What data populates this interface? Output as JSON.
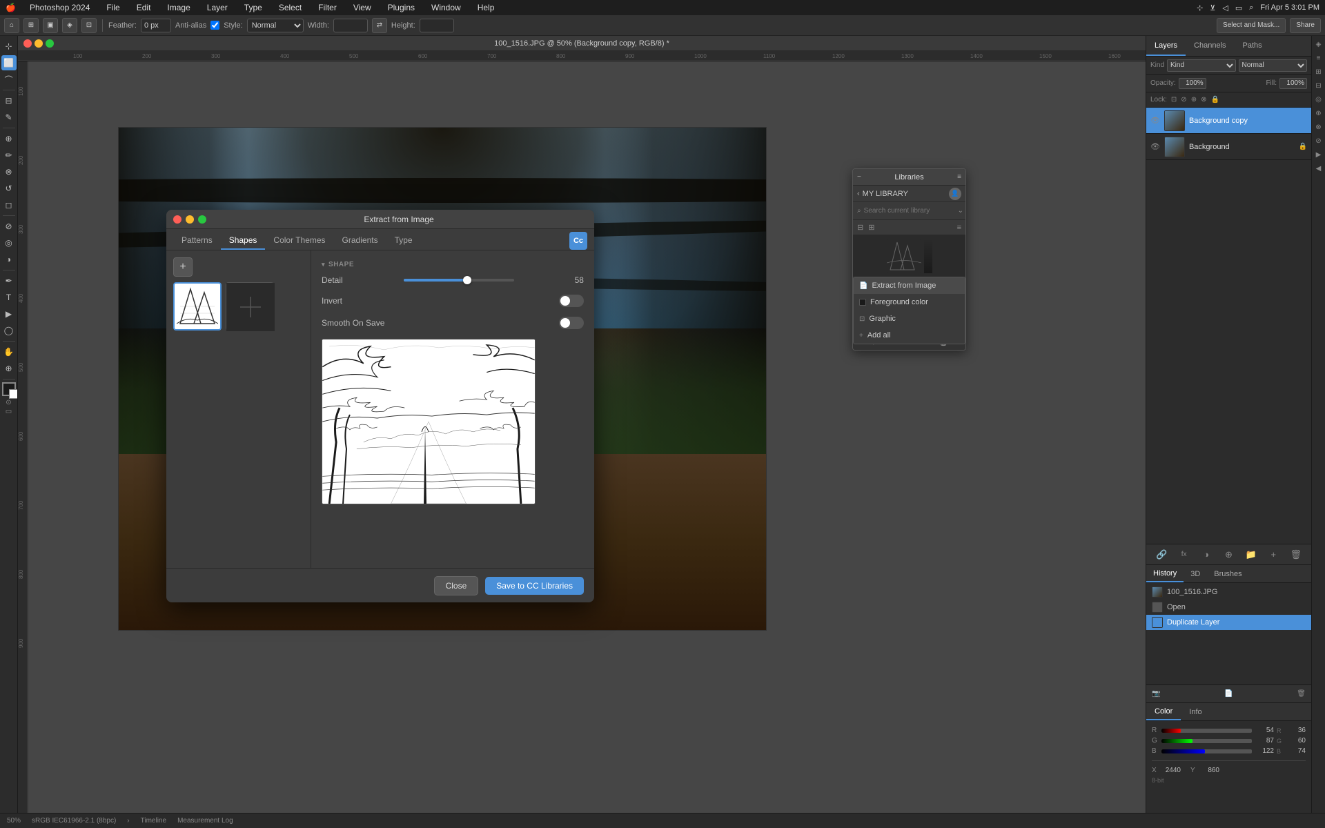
{
  "app": {
    "name": "Photoshop 2024",
    "title_bar": "100_1516.JPG @ 50% (Background copy, RGB/8) *",
    "zoom": "50%",
    "color_profile": "sRGB IEC61966-2.1 (8bpc)"
  },
  "menu_bar": {
    "apple": "🍎",
    "items": [
      "Photoshop 2024",
      "File",
      "Edit",
      "Image",
      "Layer",
      "Type",
      "Select",
      "Filter",
      "View",
      "Plugins",
      "Window",
      "Help"
    ],
    "right": [
      "bluetooth_icon",
      "wifi_icon",
      "volume_icon",
      "battery_icon",
      "search_icon",
      "Fri Apr 5  3:01 PM"
    ]
  },
  "toolbar": {
    "feather_label": "Feather:",
    "feather_value": "0 px",
    "anti_alias_label": "Anti-alias",
    "style_label": "Style:",
    "style_value": "Normal",
    "width_label": "Width:",
    "height_label": "Height:",
    "select_mask_label": "Select and Mask..."
  },
  "extract_dialog": {
    "title": "Extract from Image",
    "tabs": [
      "Patterns",
      "Shapes",
      "Color Themes",
      "Gradients",
      "Type"
    ],
    "active_tab": "Shapes",
    "cc_btn": "Cc",
    "section": "SHAPE",
    "detail_label": "Detail",
    "detail_value": "58",
    "invert_label": "Invert",
    "smooth_on_save_label": "Smooth On Save",
    "close_btn": "Close",
    "save_btn": "Save to CC Libraries"
  },
  "libraries_panel": {
    "title": "Libraries",
    "my_library": "MY LIBRARY",
    "search_placeholder": "Search current library",
    "dropdown_items": [
      {
        "label": "Extract from Image",
        "icon": "document"
      },
      {
        "label": "Foreground color",
        "icon": "color"
      },
      {
        "label": "Graphic",
        "icon": "graphic"
      },
      {
        "label": "Add all",
        "icon": "plus"
      }
    ]
  },
  "layers_panel": {
    "tabs": [
      "Layers",
      "Channels",
      "Paths"
    ],
    "active_tab": "Layers",
    "blend_mode": "Normal",
    "opacity_label": "Opacity:",
    "opacity_value": "100%",
    "fill_label": "Fill:",
    "fill_value": "100%",
    "lock_label": "Lock:",
    "layers": [
      {
        "name": "Background copy",
        "visible": true,
        "active": true,
        "locked": false
      },
      {
        "name": "Background",
        "visible": true,
        "active": false,
        "locked": true
      }
    ]
  },
  "history_panel": {
    "tabs": [
      "History",
      "3D",
      "Brushes"
    ],
    "active_tab": "History",
    "items": [
      {
        "label": "100_1516.JPG",
        "active": false
      },
      {
        "label": "Open",
        "active": false
      },
      {
        "label": "Duplicate Layer",
        "active": true
      }
    ]
  },
  "color_panel": {
    "tabs": [
      "Color",
      "Info"
    ],
    "active_tab": "Color",
    "r_label": "R",
    "g_label": "G",
    "b_label": "B",
    "r_value": "54",
    "g_value": "87",
    "b_value": "122",
    "r2_value": "36",
    "g2_value": "60",
    "b2_value": "74",
    "x_label": "X",
    "y_label": "Y",
    "x_value": "2440",
    "y_value": "860",
    "bit_depth": "8-bit"
  },
  "status_bar": {
    "zoom": "50%",
    "color_profile": "sRGB IEC61966-2.1 (8bpc)",
    "timeline_label": "Timeline",
    "measurement_log_label": "Measurement Log",
    "arrow": "›"
  },
  "icons": {
    "close": "✕",
    "minimize": "−",
    "maximize": "+",
    "eye": "👁",
    "lock": "🔒",
    "search": "⌕",
    "add": "+",
    "delete": "🗑",
    "folder": "📁",
    "link": "🔗",
    "chevron_right": "›",
    "chevron_down": "⌄",
    "chevron_left": "‹"
  }
}
